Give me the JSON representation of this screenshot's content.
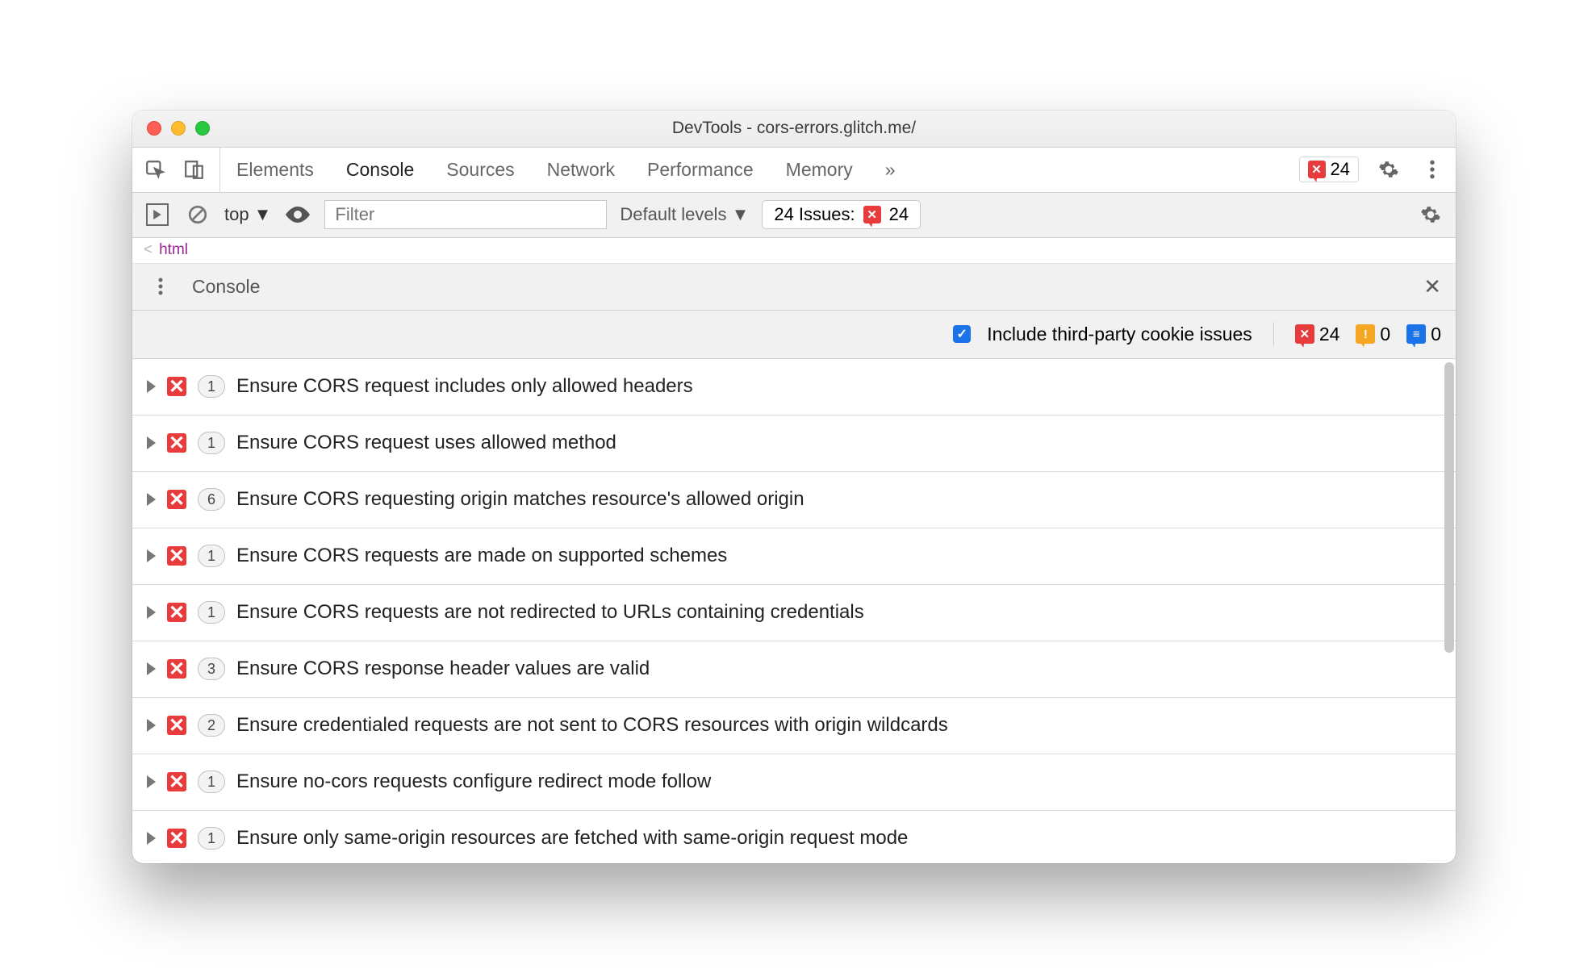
{
  "window": {
    "title": "DevTools - cors-errors.glitch.me/"
  },
  "tabs": {
    "items": [
      "Elements",
      "Console",
      "Sources",
      "Network",
      "Performance",
      "Memory"
    ],
    "active": "Console",
    "error_count": "24"
  },
  "toolbar": {
    "scope": "top",
    "filter_placeholder": "Filter",
    "levels": "Default levels",
    "issues_label": "24 Issues:",
    "issues_count": "24"
  },
  "source_snippet": {
    "arrow": "<",
    "tag": "html"
  },
  "drawer": {
    "title": "Console",
    "checkbox_label": "Include third-party cookie issues",
    "counts": {
      "errors": "24",
      "warnings": "0",
      "info": "0"
    }
  },
  "issues": [
    {
      "count": "1",
      "label": "Ensure CORS request includes only allowed headers"
    },
    {
      "count": "1",
      "label": "Ensure CORS request uses allowed method"
    },
    {
      "count": "6",
      "label": "Ensure CORS requesting origin matches resource's allowed origin"
    },
    {
      "count": "1",
      "label": "Ensure CORS requests are made on supported schemes"
    },
    {
      "count": "1",
      "label": "Ensure CORS requests are not redirected to URLs containing credentials"
    },
    {
      "count": "3",
      "label": "Ensure CORS response header values are valid"
    },
    {
      "count": "2",
      "label": "Ensure credentialed requests are not sent to CORS resources with origin wildcards"
    },
    {
      "count": "1",
      "label": "Ensure no-cors requests configure redirect mode follow"
    },
    {
      "count": "1",
      "label": "Ensure only same-origin resources are fetched with same-origin request mode"
    }
  ]
}
